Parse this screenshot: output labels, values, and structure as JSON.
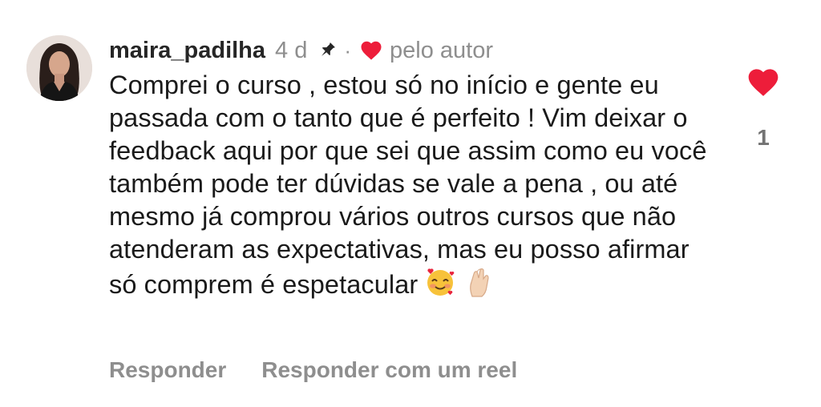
{
  "comment": {
    "username": "maira_padilha",
    "time_ago": "4 d",
    "separator": "·",
    "liked_by_label": "pelo autor",
    "text": "Comprei o curso , estou só no início e gente eu passada com o tanto que é perfeito ! Vim deixar o feedback aqui por que sei que assim como eu você também pode ter dúvidas se vale a pena , ou até mesmo já comprou vários outros cursos que não atenderam as expectativas, mas eu posso afirmar só comprem é espetacular",
    "emojis": [
      "smiling-face-with-hearts",
      "pinched-fingers-light-skin"
    ],
    "like_count": "1"
  },
  "actions": {
    "reply_label": "Responder",
    "reply_reel_label": "Responder com um reel"
  },
  "colors": {
    "heart": "#ed1d3a",
    "muted": "#8e8e8e",
    "text": "#1a1a1a"
  },
  "icons": {
    "pin": "pin-icon",
    "author_heart": "heart-icon",
    "like": "heart-icon"
  }
}
